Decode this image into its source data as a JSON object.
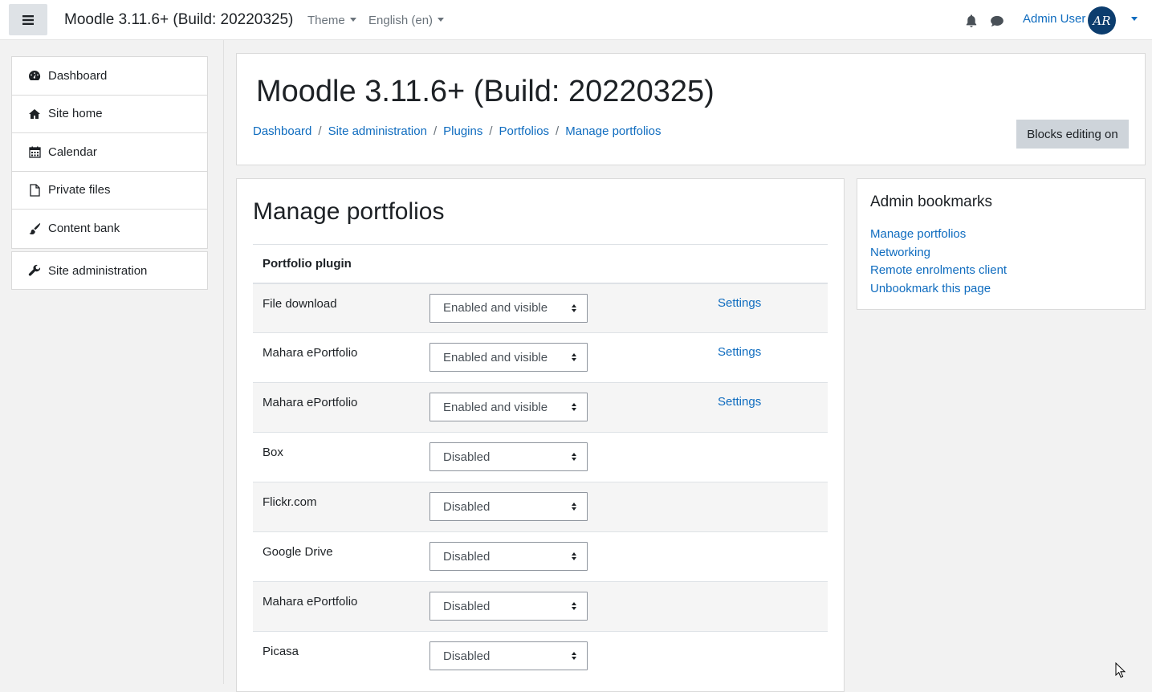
{
  "navbar": {
    "brand": "Moodle 3.11.6+ (Build: 20220325)",
    "theme_label": "Theme",
    "language_label": "English (en)",
    "user_name": "Admin User",
    "avatar_initials": "AR"
  },
  "drawer": {
    "items": [
      {
        "label": "Dashboard",
        "icon": "dashboard-icon"
      },
      {
        "label": "Site home",
        "icon": "home-icon"
      },
      {
        "label": "Calendar",
        "icon": "calendar-icon"
      },
      {
        "label": "Private files",
        "icon": "file-icon"
      },
      {
        "label": "Content bank",
        "icon": "brush-icon"
      }
    ],
    "admin_item": {
      "label": "Site administration",
      "icon": "wrench-icon"
    }
  },
  "header": {
    "title": "Moodle 3.11.6+ (Build: 20220325)",
    "breadcrumb": [
      "Dashboard",
      "Site administration",
      "Plugins",
      "Portfolios",
      "Manage portfolios"
    ],
    "blocks_editing_label": "Blocks editing on"
  },
  "main": {
    "heading": "Manage portfolios",
    "table_header": "Portfolio plugin",
    "rows": [
      {
        "name": "File download",
        "value": "Enabled and visible",
        "settings": "Settings"
      },
      {
        "name": "Mahara ePortfolio",
        "value": "Enabled and visible",
        "settings": "Settings"
      },
      {
        "name": "Mahara ePortfolio",
        "value": "Enabled and visible",
        "settings": "Settings"
      },
      {
        "name": "Box",
        "value": "Disabled",
        "settings": ""
      },
      {
        "name": "Flickr.com",
        "value": "Disabled",
        "settings": ""
      },
      {
        "name": "Google Drive",
        "value": "Disabled",
        "settings": ""
      },
      {
        "name": "Mahara ePortfolio",
        "value": "Disabled",
        "settings": ""
      },
      {
        "name": "Picasa",
        "value": "Disabled",
        "settings": ""
      }
    ]
  },
  "bookmarks": {
    "title": "Admin bookmarks",
    "links": [
      "Manage portfolios",
      "Networking",
      "Remote enrolments client",
      "Unbookmark this page"
    ]
  },
  "colors": {
    "link": "#0f6cbf",
    "text": "#1d2125",
    "avatar_bg": "#0c3d6e",
    "button_bg": "#ced4da"
  }
}
